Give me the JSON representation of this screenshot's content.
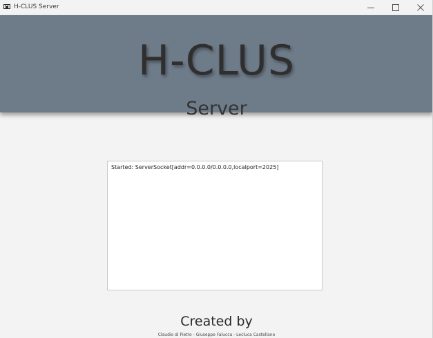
{
  "window": {
    "title": "H-CLUS Server",
    "icon": "java-app-icon",
    "controls": {
      "minimize": "minimize-icon",
      "maximize": "maximize-icon",
      "close": "close-icon"
    }
  },
  "header": {
    "title": "H-CLUS",
    "subtitle": "Server",
    "background_color": "#6e7b89"
  },
  "log": {
    "lines": [
      "Started: ServerSocket[addr=0.0.0.0/0.0.0.0,localport=2025]"
    ]
  },
  "footer": {
    "title": "Created by",
    "names": "Claudio di Pietro - Giuseppe Falucca - Lecluca Castellano"
  }
}
